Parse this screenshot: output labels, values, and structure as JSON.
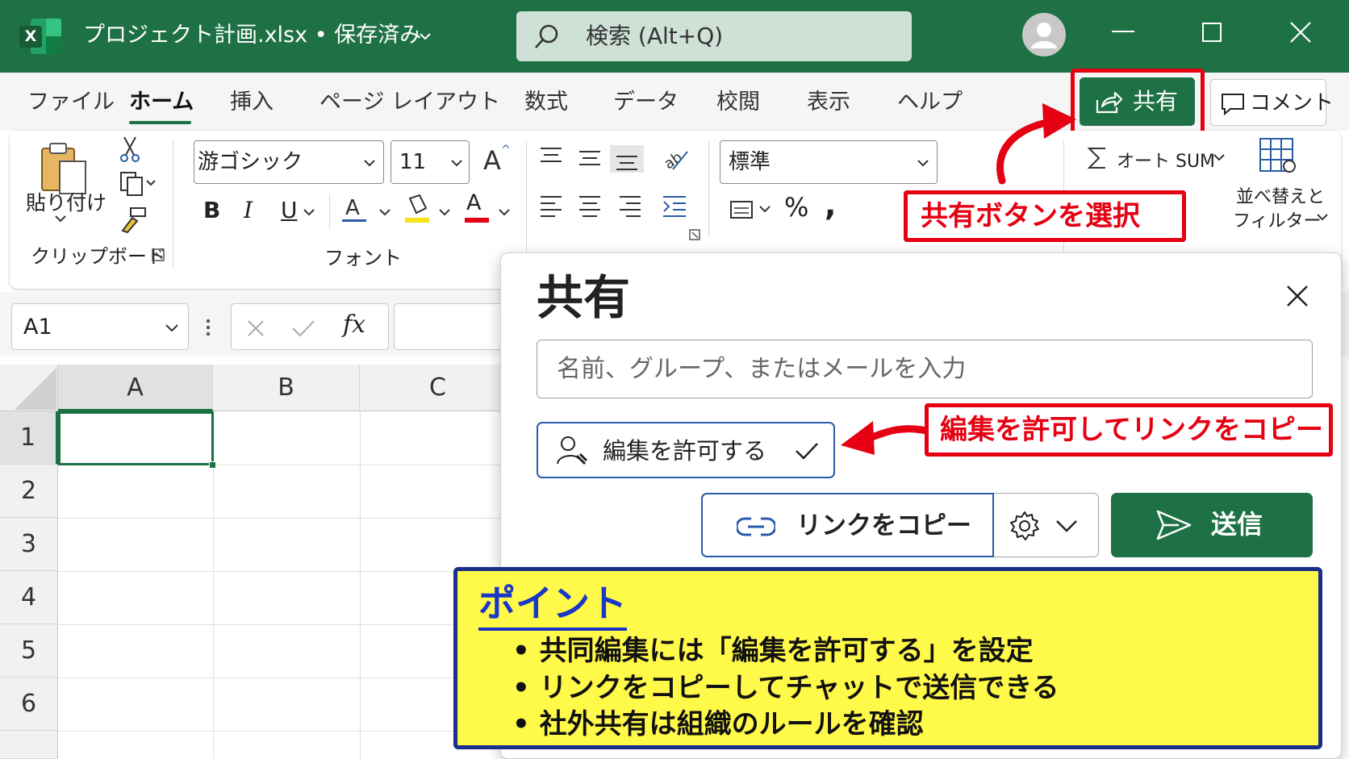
{
  "titlebar": {
    "app_icon_letter": "X",
    "doc_title": "プロジェクト計画.xlsx • 保存済み",
    "search_placeholder": "検索 (Alt+Q)"
  },
  "menu": {
    "tabs": [
      "ファイル",
      "ホーム",
      "挿入",
      "ページ レイアウト",
      "数式",
      "データ",
      "校閲",
      "表示",
      "ヘルプ"
    ],
    "active_tab": "ホーム",
    "share_label": "共有",
    "comment_label": "コメント"
  },
  "ribbon": {
    "paste_label": "貼り付け",
    "clipboard_group": "クリップボード",
    "font_name": "游ゴシック",
    "font_size": "11",
    "font_group": "フォント",
    "number_format": "標準",
    "autosum_label": "オート SUM",
    "sort_filter_line1": "並べ替えと",
    "sort_filter_line2": "フィルター",
    "bold": "B",
    "italic": "I",
    "underline": "U",
    "font_color_letter": "A",
    "percent": "%",
    "comma": ","
  },
  "formula_bar": {
    "name_box": "A1",
    "fx": "fx"
  },
  "grid": {
    "columns": [
      "A",
      "B",
      "C"
    ],
    "rows": [
      "1",
      "2",
      "3",
      "4",
      "5",
      "6"
    ],
    "selected_cell": "A1"
  },
  "share_panel": {
    "title": "共有",
    "people_placeholder": "名前、グループ、またはメールを入力",
    "permission_label": "編集を許可する",
    "copy_link_label": "リンクをコピー",
    "send_label": "送信"
  },
  "annotations": {
    "share_callout": "共有ボタンを選択",
    "link_callout": "編集を許可してリンクをコピー",
    "point_title": "ポイント",
    "points": [
      "• 共同編集には「編集を許可する」を設定",
      "• リンクをコピーしてチャットで送信できる",
      "• 社外共有は組織のルールを確認"
    ]
  },
  "colors": {
    "excel_green": "#1e7145",
    "callout_red": "#e50012",
    "point_yellow": "#fff94a",
    "point_navy": "#1a2e8a"
  }
}
